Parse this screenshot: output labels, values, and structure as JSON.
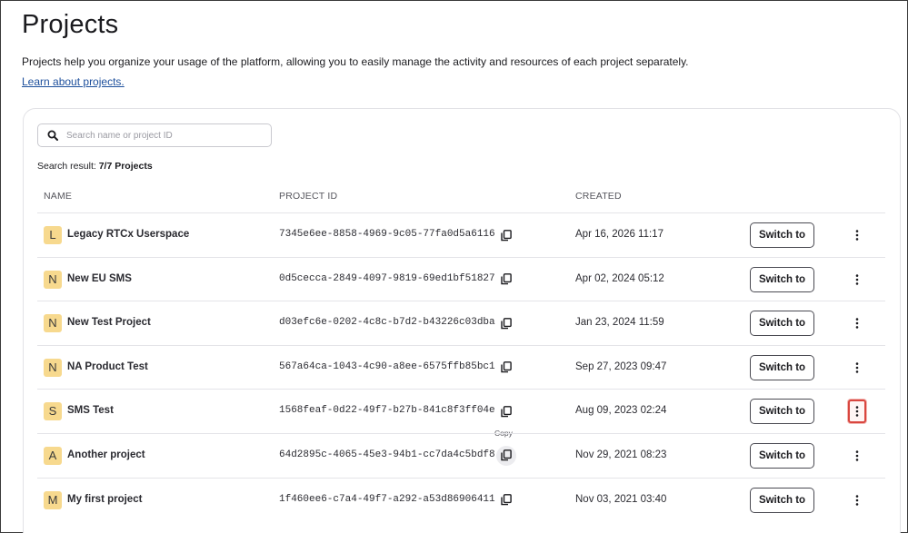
{
  "page": {
    "title": "Projects",
    "description": "Projects help you organize your usage of the platform, allowing you to easily manage the activity and resources of each project separately.",
    "learn_link": "Learn about projects."
  },
  "search": {
    "placeholder": "Search name or project ID",
    "value": "",
    "result_prefix": "Search result:",
    "result_count": "7/7 Projects"
  },
  "table": {
    "columns": {
      "name": "NAME",
      "project_id": "PROJECT ID",
      "created": "CREATED"
    },
    "switch_label": "Switch to",
    "copy_tooltip": "Copy",
    "rows": [
      {
        "initial": "L",
        "name": "Legacy RTCx Userspace",
        "project_id": "7345e6ee-8858-4969-9c05-77fa0d5a6116",
        "created": "Apr 16, 2026 11:17"
      },
      {
        "initial": "N",
        "name": "New EU SMS",
        "project_id": "0d5cecca-2849-4097-9819-69ed1bf51827",
        "created": "Apr 02, 2024 05:12"
      },
      {
        "initial": "N",
        "name": "New Test Project",
        "project_id": "d03efc6e-0202-4c8c-b7d2-b43226c03dba",
        "created": "Jan 23, 2024 11:59"
      },
      {
        "initial": "N",
        "name": "NA Product Test",
        "project_id": "567a64ca-1043-4c90-a8ee-6575ffb85bc1",
        "created": "Sep 27, 2023 09:47"
      },
      {
        "initial": "S",
        "name": "SMS Test",
        "project_id": "1568feaf-0d22-49f7-b27b-841c8f3ff04e",
        "created": "Aug 09, 2023 02:24"
      },
      {
        "initial": "A",
        "name": "Another project",
        "project_id": "64d2895c-4065-45e3-94b1-cc7da4c5bdf8",
        "created": "Nov 29, 2021 08:23"
      },
      {
        "initial": "M",
        "name": "My first project",
        "project_id": "1f460ee6-c7a4-49f7-a292-a53d86906411",
        "created": "Nov 03, 2021 03:40"
      }
    ]
  },
  "colors": {
    "avatar_bg": "#f7d98e",
    "link": "#1d4f9c",
    "highlight_border": "#d9463f"
  },
  "icons": {
    "search": "search-icon",
    "copy": "copy-icon",
    "more": "more-vertical-icon"
  }
}
